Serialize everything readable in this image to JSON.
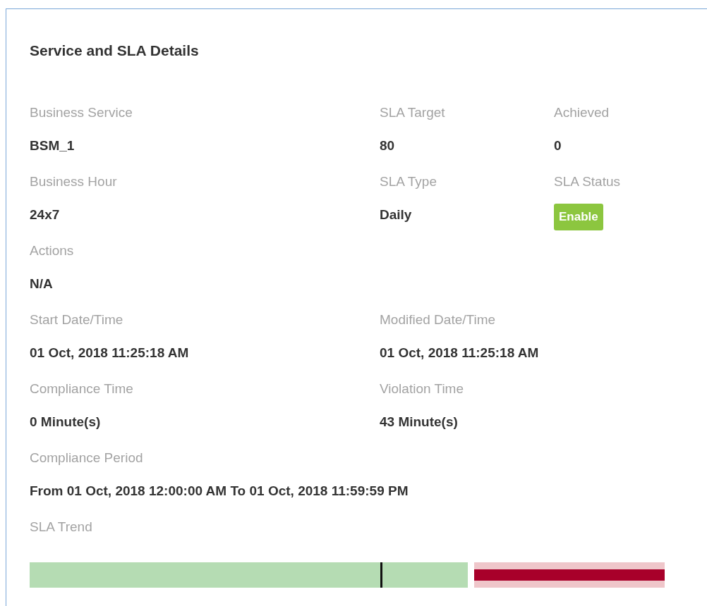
{
  "panel": {
    "title": "Service and SLA Details"
  },
  "rows": [
    {
      "fields": [
        {
          "label": "Business Service",
          "value": "BSM_1",
          "kind": "text"
        },
        {
          "label": "SLA Target",
          "value": "80",
          "kind": "text"
        },
        {
          "label": "Achieved",
          "value": "0",
          "kind": "text"
        }
      ]
    },
    {
      "fields": [
        {
          "label": "Business Hour",
          "value": "24x7",
          "kind": "text"
        },
        {
          "label": "SLA Type",
          "value": "Daily",
          "kind": "text"
        },
        {
          "label": "SLA Status",
          "value": "Enable",
          "kind": "badge",
          "color": "#8cc63f"
        }
      ]
    },
    {
      "fields": [
        {
          "label": "Actions",
          "value": "N/A",
          "kind": "text"
        }
      ]
    },
    {
      "fields": [
        {
          "label": "Start Date/Time",
          "value": "01 Oct, 2018 11:25:18 AM",
          "kind": "text"
        },
        {
          "label": "Modified Date/Time",
          "value": "01 Oct, 2018 11:25:18 AM",
          "kind": "text"
        }
      ]
    },
    {
      "fields": [
        {
          "label": "Compliance Time",
          "value": "0 Minute(s)",
          "kind": "text"
        },
        {
          "label": "Violation Time",
          "value": "43 Minute(s)",
          "kind": "text"
        }
      ]
    },
    {
      "fields": [
        {
          "label": "Compliance Period",
          "value": "From 01 Oct, 2018 12:00:00 AM To 01 Oct, 2018 11:59:59 PM",
          "kind": "text"
        }
      ]
    }
  ],
  "sla_trend": {
    "label": "SLA Trend",
    "marker": {
      "level": 0.8
    },
    "segments": [
      {
        "kind": "compliance",
        "color": "#b5dcb3"
      },
      {
        "kind": "violation",
        "color": "#a8002a"
      }
    ]
  }
}
